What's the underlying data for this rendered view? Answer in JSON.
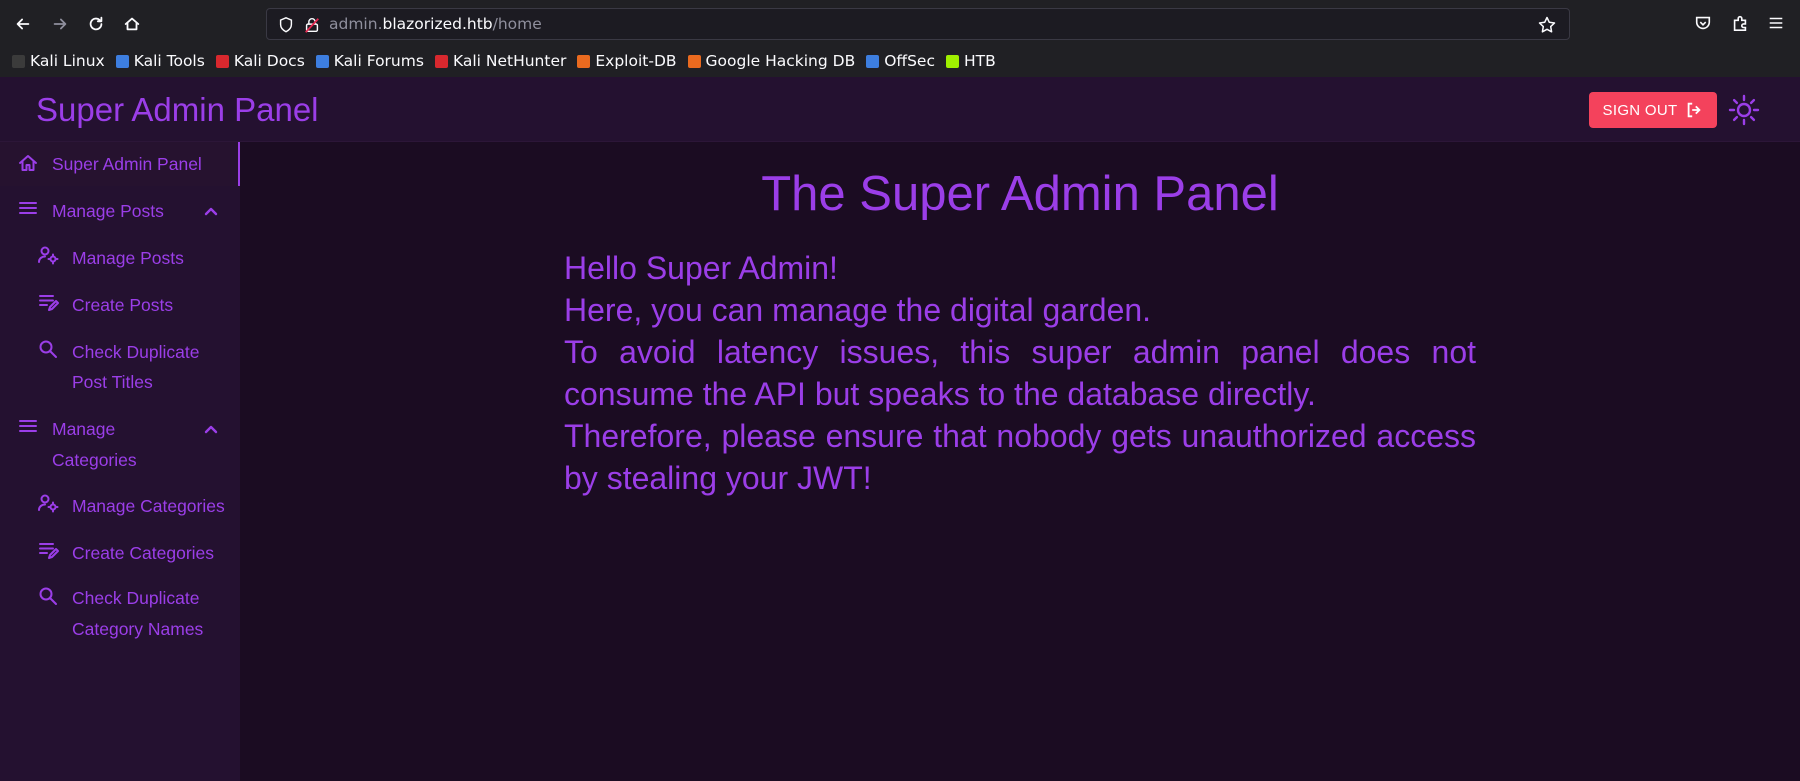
{
  "browser": {
    "url_prefix": "admin.",
    "url_domain": "blazorized.htb",
    "url_path": "/home",
    "bookmarks": [
      {
        "label": "Kali Linux",
        "color": "#3b3b3b"
      },
      {
        "label": "Kali Tools",
        "color": "#3d7ee0"
      },
      {
        "label": "Kali Docs",
        "color": "#d8282e"
      },
      {
        "label": "Kali Forums",
        "color": "#3d7ee0"
      },
      {
        "label": "Kali NetHunter",
        "color": "#d8282e"
      },
      {
        "label": "Exploit-DB",
        "color": "#ea6a1f"
      },
      {
        "label": "Google Hacking DB",
        "color": "#ea6a1f"
      },
      {
        "label": "OffSec",
        "color": "#3d7ee0"
      },
      {
        "label": "HTB",
        "color": "#9fef00"
      }
    ]
  },
  "header": {
    "title": "Super Admin Panel",
    "signout_label": "SIGN OUT"
  },
  "sidebar": {
    "items": [
      {
        "label": "Super Admin Panel",
        "icon": "home-icon"
      },
      {
        "label": "Manage Posts",
        "icon": "menu-icon"
      },
      {
        "label": "Manage Posts",
        "icon": "user-cog-icon"
      },
      {
        "label": "Create Posts",
        "icon": "edit-list-icon"
      },
      {
        "label": "Check Duplicate",
        "label2": "Post Titles",
        "icon": "search-icon"
      },
      {
        "label": "Manage",
        "label2": "Categories",
        "icon": "menu-icon"
      },
      {
        "label": "Manage Categories",
        "icon": "user-cog-icon"
      },
      {
        "label": "Create Categories",
        "icon": "edit-list-icon"
      },
      {
        "label": "Check Duplicate",
        "label2": "Category Names",
        "icon": "search-icon"
      }
    ]
  },
  "main": {
    "title": "The Super Admin Panel",
    "lines": [
      "Hello Super Admin!",
      "Here, you can manage the digital garden.",
      "To avoid latency issues, this super admin panel does not consume the API but speaks to the database directly.",
      "Therefore, please ensure that nobody gets unauthorized access by stealing your JWT!"
    ]
  },
  "colors": {
    "accent": "#9b3ee8",
    "signout": "#f4425c",
    "background": "#1b0c22",
    "sidebar": "#241130"
  }
}
